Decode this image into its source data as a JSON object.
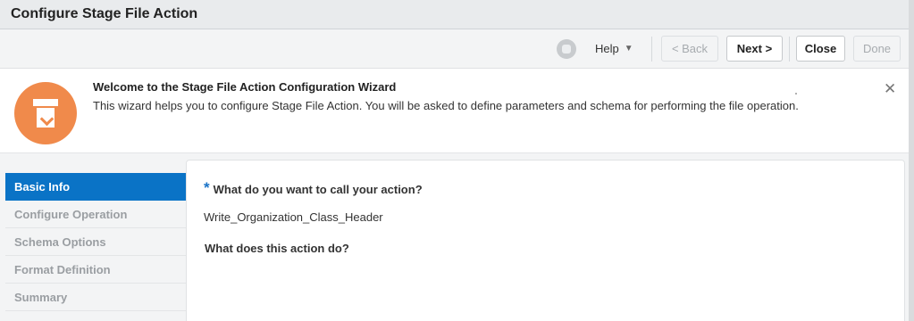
{
  "window": {
    "title": "Configure Stage File Action"
  },
  "toolbar": {
    "help_label": "Help",
    "back_label": "< Back",
    "next_label": "Next >",
    "close_label": "Close",
    "done_label": "Done"
  },
  "banner": {
    "heading": "Welcome to the Stage File Action Configuration Wizard",
    "text": "This wizard helps you to configure Stage File Action. You will be asked to define parameters and schema for performing the file operation.",
    "close_symbol": "✕"
  },
  "steps": [
    {
      "label": "Basic Info",
      "active": true
    },
    {
      "label": "Configure Operation",
      "active": false
    },
    {
      "label": "Schema Options",
      "active": false
    },
    {
      "label": "Format Definition",
      "active": false
    },
    {
      "label": "Summary",
      "active": false
    }
  ],
  "form": {
    "required_marker": "*",
    "q1_label": "What do you want to call your action?",
    "q1_value": "Write_Organization_Class_Header",
    "q2_label": "What does this action do?"
  },
  "colors": {
    "accent": "#0a73c6",
    "wizard_icon": "#f08a4b"
  }
}
